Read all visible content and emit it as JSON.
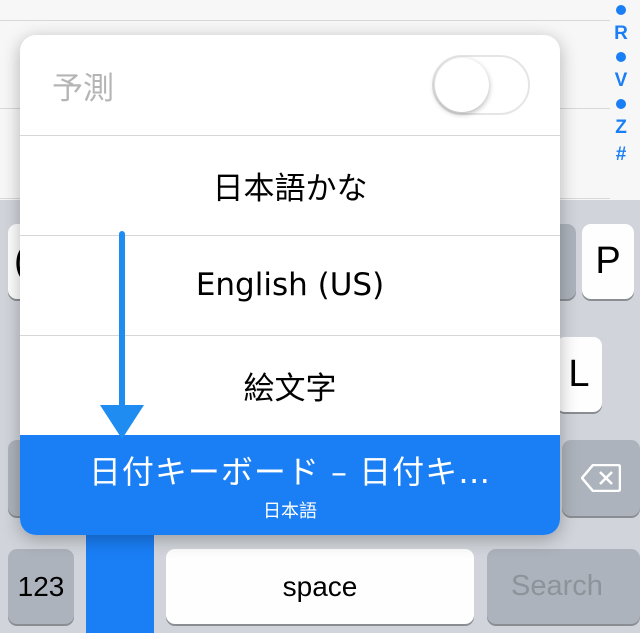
{
  "index_bar": {
    "letters": [
      "R",
      "V",
      "Z",
      "#"
    ]
  },
  "popover": {
    "predict_label": "予測",
    "predict_on": false,
    "items": [
      {
        "label": "日本語かな"
      },
      {
        "label": "English (US)"
      },
      {
        "label": "絵文字"
      }
    ],
    "selected": {
      "title": "日付キーボード – 日付キ…",
      "subtitle": "日本語"
    }
  },
  "keys": {
    "p": "P",
    "l": "L",
    "partial_left": "(",
    "numbers": "123",
    "space": "space",
    "search": "Search"
  },
  "colors": {
    "accent": "#1a7ef5",
    "keyboard_bg": "#d1d5db",
    "key_bg": "#fefefe",
    "search_text": "#8e939a"
  }
}
